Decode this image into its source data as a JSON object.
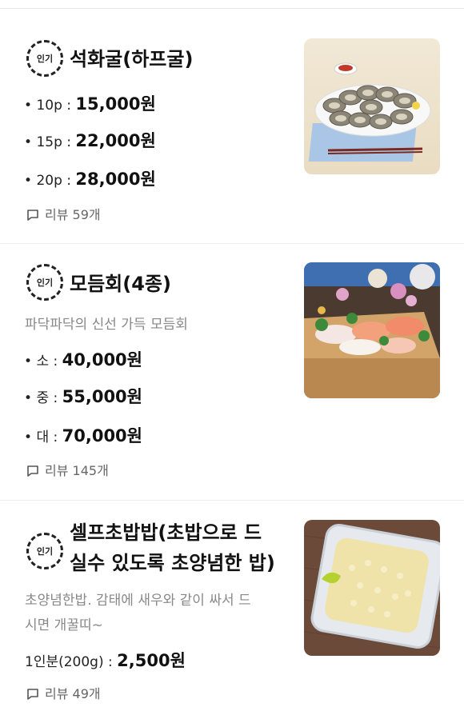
{
  "items": [
    {
      "badge": "인기",
      "title": "석화굴(하프굴)",
      "options": [
        {
          "label": "10p :",
          "price": "15,000원"
        },
        {
          "label": "15p :",
          "price": "22,000원"
        },
        {
          "label": "20p :",
          "price": "28,000원"
        }
      ],
      "review": "리뷰 59개",
      "image": "oyster-platter-photo"
    },
    {
      "badge": "인기",
      "title": "모듬회(4종)",
      "description": "파닥파닥의 신선 가득 모듬회",
      "options": [
        {
          "label": "소 :",
          "price": "40,000원"
        },
        {
          "label": "중 :",
          "price": "55,000원"
        },
        {
          "label": "대 :",
          "price": "70,000원"
        }
      ],
      "review": "리뷰 145개",
      "image": "sashimi-platter-photo"
    },
    {
      "badge": "인기",
      "title_line1": "셀프초밥밥(초밥으로 드",
      "title_line2": "실수 있도록 초양념한 밥)",
      "description_line1": "초양념한밥. 감태에 새우와 같이 싸서 드",
      "description_line2": "시면 개꿀띠~",
      "option": {
        "label": "1인분(200g) :",
        "price": "2,500원"
      },
      "review": "리뷰 49개",
      "image": "seasoned-rice-container-photo"
    }
  ]
}
